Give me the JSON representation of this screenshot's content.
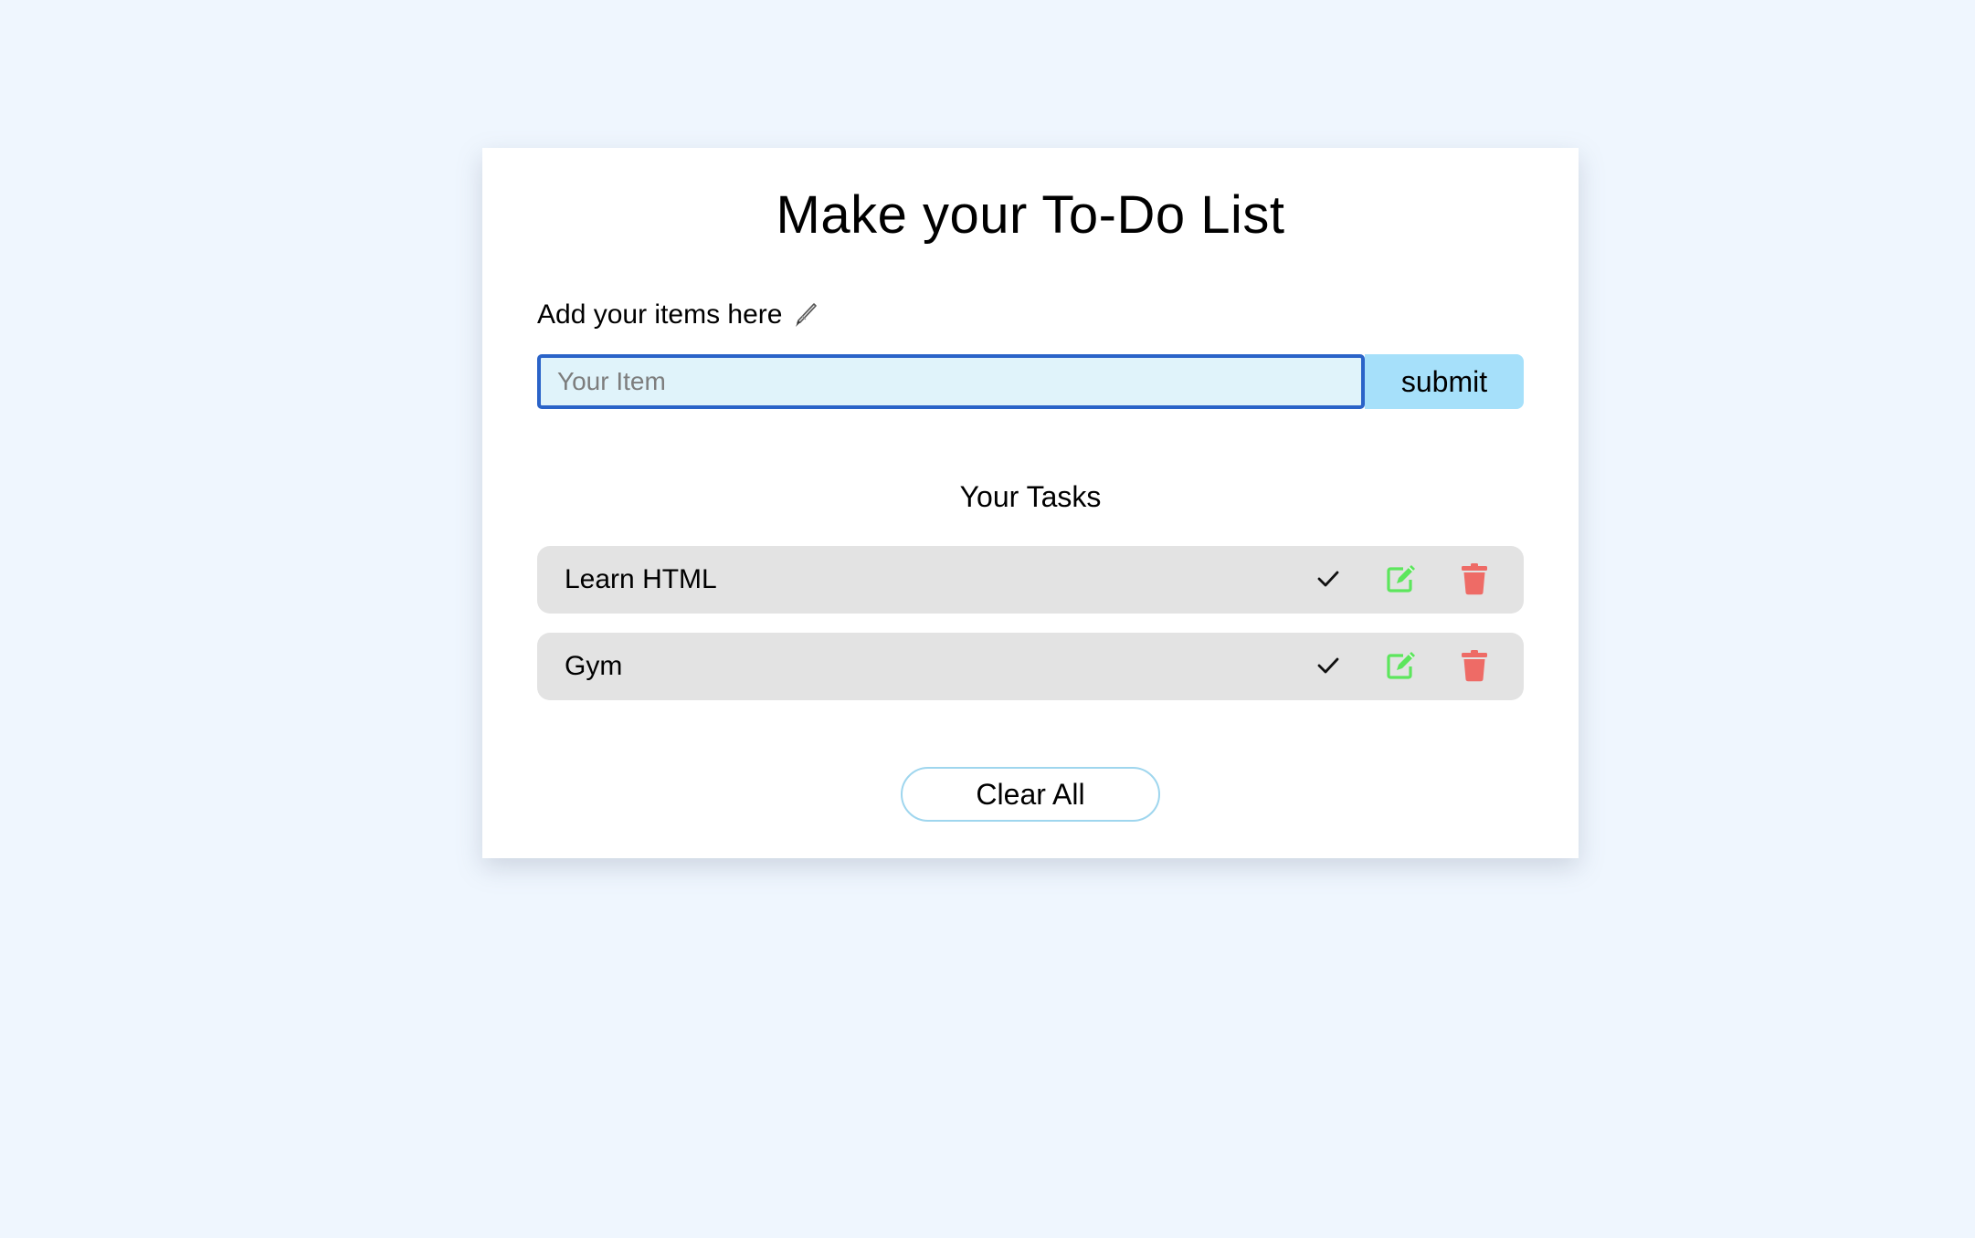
{
  "header": {
    "title": "Make your To-Do List"
  },
  "add_form": {
    "label": "Add your items here",
    "label_icon": "pen-icon",
    "input_placeholder": "Your Item",
    "input_value": "",
    "submit_label": "submit"
  },
  "tasks": {
    "heading": "Your Tasks",
    "items": [
      {
        "text": "Learn HTML",
        "actions": [
          "check-icon",
          "edit-icon",
          "trash-icon"
        ]
      },
      {
        "text": "Gym",
        "actions": [
          "check-icon",
          "edit-icon",
          "trash-icon"
        ]
      }
    ]
  },
  "footer": {
    "clear_label": "Clear All"
  },
  "colors": {
    "background": "#eff6fe",
    "card": "#ffffff",
    "input_bg": "#e0f3fa",
    "input_border": "#2a63c8",
    "submit_bg": "#a6e0fa",
    "task_row_bg": "#e3e3e3",
    "edit_icon": "#5ce65c",
    "delete_icon": "#ee6b66",
    "clear_border": "#9fd6ee"
  }
}
